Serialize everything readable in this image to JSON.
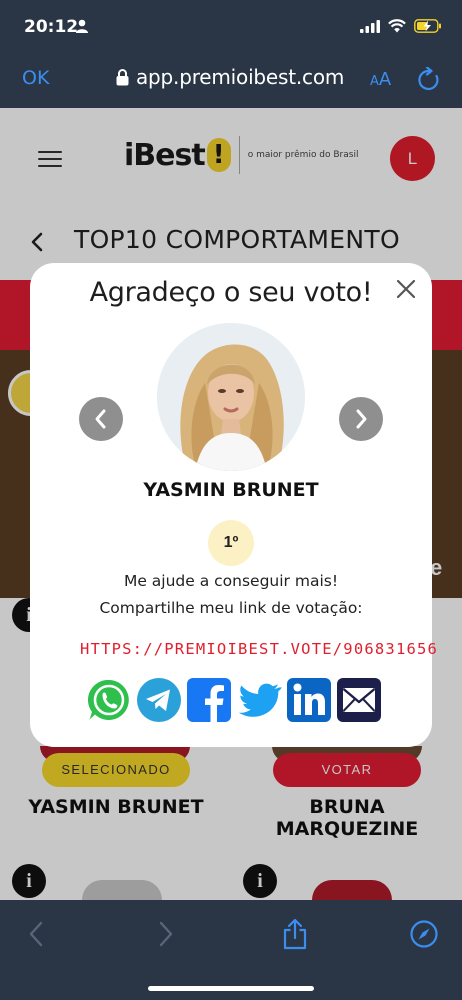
{
  "status_bar": {
    "time": "20:12"
  },
  "browser": {
    "done_label": "OK",
    "url": "app.premioibest.com",
    "text_size_small": "A",
    "text_size_large": "A"
  },
  "header": {
    "logo_text": "iBest",
    "logo_mark": "!",
    "tagline": "o maior prêmio do Brasil",
    "user_initial": "L"
  },
  "category": {
    "title": "TOP10 COMPORTAMENTO"
  },
  "candidates": [
    {
      "name": "YASMIN BRUNET",
      "button": "SELECIONADO"
    },
    {
      "name_line1": "BRUNA",
      "name_line2": "MARQUEZINE",
      "button": "VOTAR"
    }
  ],
  "strip_letter": "e",
  "info_label": "i",
  "modal": {
    "title": "Agradeço o seu voto!",
    "candidate_name": "YASMIN BRUNET",
    "rank": "1º",
    "message_line1": "Me ajude a conseguir mais!",
    "message_line2": "Compartilhe meu link de votação:",
    "vote_link": "HTTPS://PREMIOIBEST.VOTE/906831656"
  },
  "share_icons": [
    "whatsapp-icon",
    "telegram-icon",
    "facebook-icon",
    "twitter-icon",
    "linkedin-icon",
    "email-icon"
  ],
  "colors": {
    "brand_red": "#e21c34",
    "brand_yellow": "#f7d82a",
    "safari_blue": "#3b8ef0",
    "chrome_bg": "#2a3545"
  }
}
